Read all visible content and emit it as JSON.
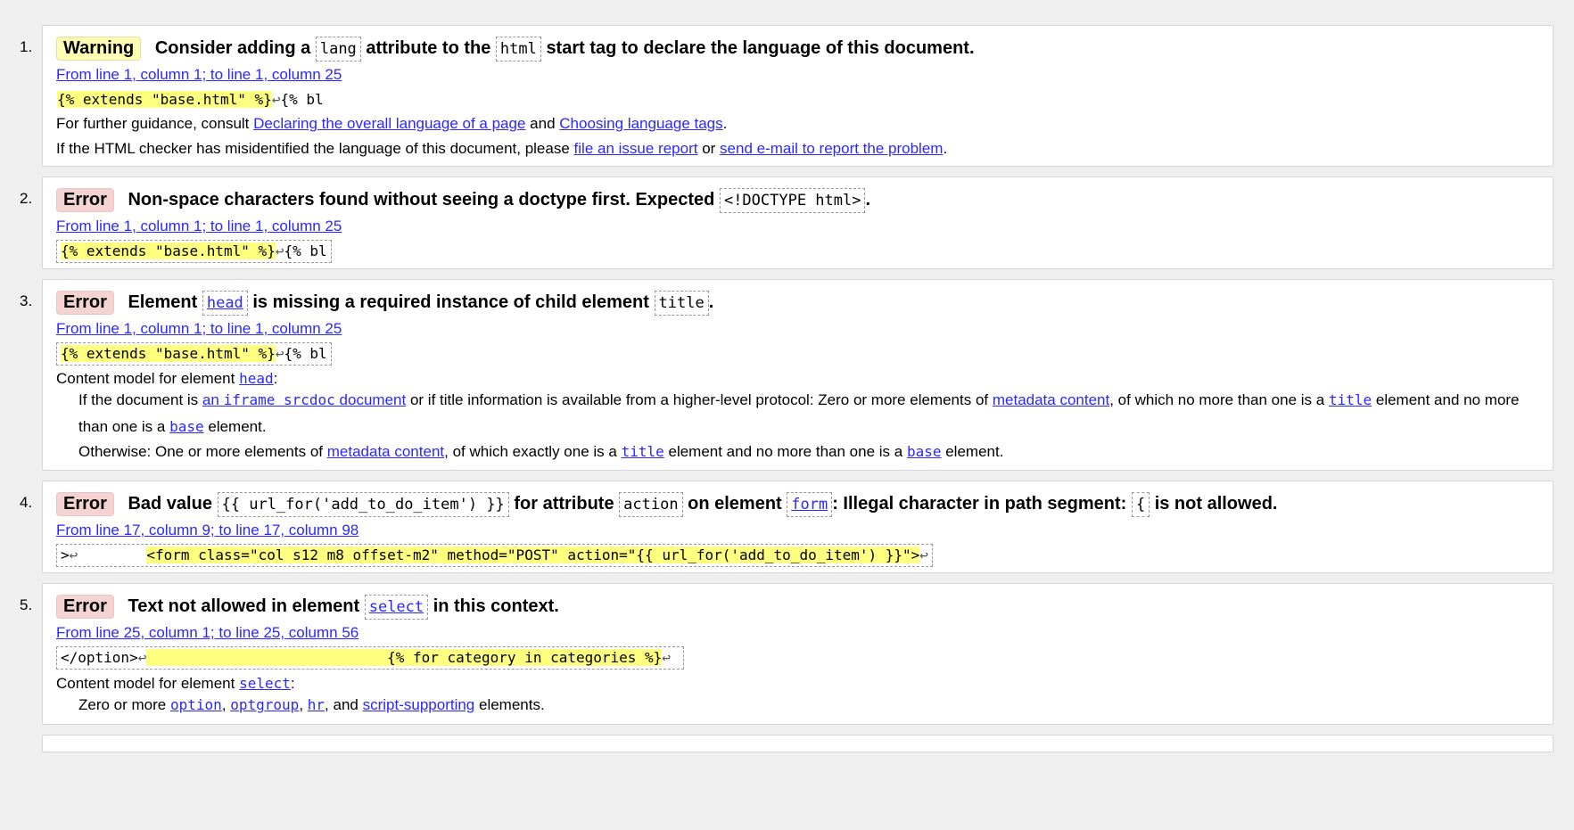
{
  "messages": [
    {
      "num": "1.",
      "type": "Warning",
      "m1": "Consider adding a",
      "c1": "lang",
      "m2": "attribute to the",
      "c2": "html",
      "m3": "start tag to declare the language of this document.",
      "loc": "From line 1, column 1; to line 1, column 25",
      "ext_hl": "{% extends \"base.html\" %}",
      "ext_rest": "{% bl",
      "g1_a": "For further guidance, consult",
      "g1_link1": "Declaring the overall language of a page",
      "g1_and": "and",
      "g1_link2": "Choosing language tags",
      "g1_end": ".",
      "g2_a": "If the HTML checker has misidentified the language of this document, please",
      "g2_link1": "file an issue report",
      "g2_or": "or",
      "g2_link2": "send e-mail to report the problem",
      "g2_end": "."
    },
    {
      "num": "2.",
      "type": "Error",
      "m1": "Non-space characters found without seeing a doctype first. Expected",
      "c1": "<!DOCTYPE html>",
      "m2": ".",
      "loc": "From line 1, column 1; to line 1, column 25",
      "ext_hl": "{% extends \"base.html\" %}",
      "ext_rest": "{% bl"
    },
    {
      "num": "3.",
      "type": "Error",
      "m1": "Element",
      "c1": "head",
      "m2": "is missing a required instance of child element",
      "c2": "title",
      "m3": ".",
      "loc": "From line 1, column 1; to line 1, column 25",
      "ext_hl": "{% extends \"base.html\" %}",
      "ext_rest": "{% bl",
      "cm_label": "Content model for element",
      "cm_el": "head",
      "cm_colon": ":",
      "p1_a": "If the document is",
      "p1_link1a": "an",
      "p1_link1b": "iframe srcdoc",
      "p1_link1c": "document",
      "p1_b": "or if title information is available from a higher-level protocol: Zero or more elements of",
      "p1_link2": "metadata content",
      "p1_c": ", of which no more than one is a",
      "p1_link3": "title",
      "p1_d": "element and no more than one is a",
      "p1_link4": "base",
      "p1_e": "element.",
      "p2_a": "Otherwise: One or more elements of",
      "p2_link1": "metadata content",
      "p2_b": ", of which exactly one is a",
      "p2_link2": "title",
      "p2_c": "element and no more than one is a",
      "p2_link3": "base",
      "p2_d": "element."
    },
    {
      "num": "4.",
      "type": "Error",
      "m1": "Bad value",
      "c1": "{{ url_for('add_to_do_item') }}",
      "m2": "for attribute",
      "c2": "action",
      "m3": "on element",
      "c3": "form",
      "m4": ": Illegal character in path segment:",
      "c4": "{",
      "m5": "is not allowed.",
      "loc": "From line 17, column 9; to line 17, column 98",
      "ext_pre": ">",
      "ext_hl": "<form class=\"col s12 m8 offset-m2\" method=\"POST\" action=\"{{ url_for('add_to_do_item') }}\">",
      "ext_rest": ""
    },
    {
      "num": "5.",
      "type": "Error",
      "m1": "Text not allowed in element",
      "c1": "select",
      "m2": "in this context.",
      "loc": "From line 25, column 1; to line 25, column 56",
      "ext_pre": "</option>",
      "ext_hl": "                            {% for category in categories %}",
      "cm_label": "Content model for element",
      "cm_el": "select",
      "cm_colon": ":",
      "z_a": "Zero or more",
      "z_l1": "option",
      "z_l2": "optgroup",
      "z_l3": "hr",
      "z_and": ", and",
      "z_l4": "script-supporting",
      "z_end": "elements."
    }
  ],
  "symbols": {
    "return": "↩",
    "comma": ","
  }
}
